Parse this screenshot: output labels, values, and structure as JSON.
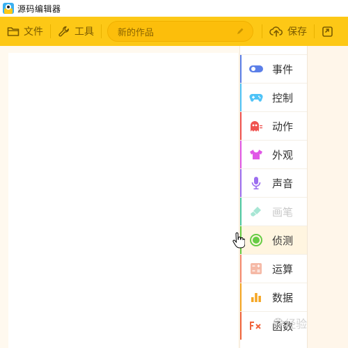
{
  "window": {
    "title": "源码编辑器"
  },
  "toolbar": {
    "file_label": "文件",
    "tools_label": "工具",
    "project_name": "新的作品",
    "save_label": "保存"
  },
  "categories": [
    {
      "label": "事件",
      "icon": "toggle-icon",
      "color": "#5b7fe8",
      "state": "normal"
    },
    {
      "label": "控制",
      "icon": "gamepad-icon",
      "color": "#4fc3f7",
      "state": "normal"
    },
    {
      "label": "动作",
      "icon": "ghost-icon",
      "color": "#ef5350",
      "state": "normal"
    },
    {
      "label": "外观",
      "icon": "shirt-icon",
      "color": "#e057e6",
      "state": "normal"
    },
    {
      "label": "声音",
      "icon": "microphone-icon",
      "color": "#9c6ef0",
      "state": "normal"
    },
    {
      "label": "画笔",
      "icon": "brush-icon",
      "color": "#4dc9a3",
      "state": "disabled"
    },
    {
      "label": "侦测",
      "icon": "target-icon",
      "color": "#66cc44",
      "state": "active"
    },
    {
      "label": "运算",
      "icon": "calculator-icon",
      "color": "#f58a6e",
      "state": "normal"
    },
    {
      "label": "数据",
      "icon": "bar-chart-icon",
      "color": "#f5a623",
      "state": "normal"
    },
    {
      "label": "函数",
      "icon": "function-icon",
      "color": "#f0643c",
      "state": "normal"
    }
  ],
  "watermark": {
    "text": "经验"
  }
}
